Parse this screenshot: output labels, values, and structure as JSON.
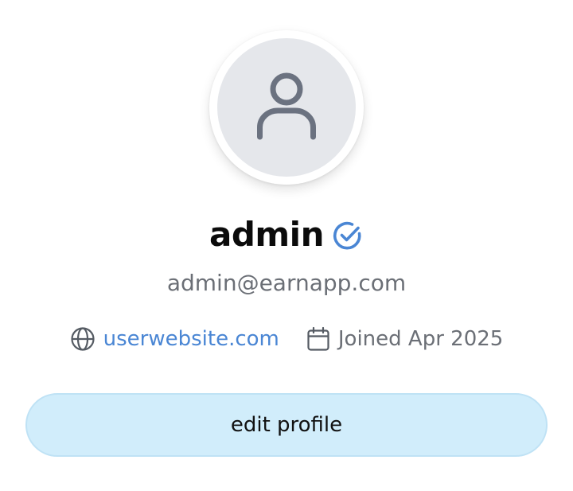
{
  "profile": {
    "avatar_icon": "user-icon",
    "name": "admin",
    "verified_icon": "check-circle-icon",
    "email": "admin@earnapp.com",
    "website": "userwebsite.com",
    "website_icon": "globe-icon",
    "joined": "Joined Apr 2025",
    "joined_icon": "calendar-icon"
  },
  "actions": {
    "edit_label": "edit profile"
  },
  "colors": {
    "accent": "#4a86d4",
    "button_bg": "#d1edfb",
    "muted_text": "#6b6f76",
    "avatar_bg": "#e5e7eb"
  }
}
